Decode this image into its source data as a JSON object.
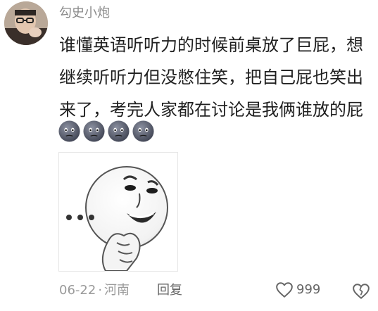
{
  "comment": {
    "username": "勾史小炮",
    "text_lines": [
      "谁懂英语听听力的时候前桌放了巨屁，想",
      "继续听听力但没憋住笑，把自己屁也笑出",
      "来了，考完人家都在讨论是我俩谁放的屁"
    ],
    "emoji_names": [
      "sweat-face-icon",
      "sweat-face-icon",
      "sweat-face-icon",
      "sweat-face-icon"
    ],
    "sticker_name": "smug-meme-face-sticker",
    "date": "06-22",
    "separator": "·",
    "location": "河南",
    "reply_label": "回复",
    "like_count": "999"
  },
  "colors": {
    "username": "#8a8a8a",
    "text": "#1f1f1f",
    "meta": "#9a9a9a",
    "emoji_base": "#5a5f6e"
  }
}
